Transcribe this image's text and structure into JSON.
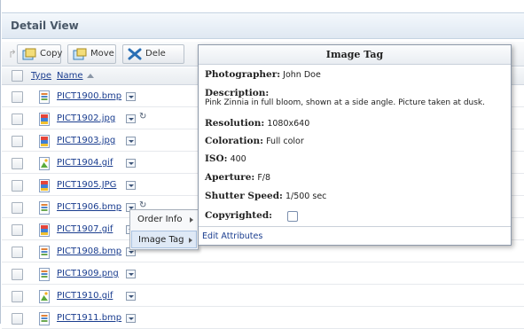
{
  "panel": {
    "title": "Detail View"
  },
  "toolbar": {
    "disabled_icon": "↱",
    "buttons": [
      {
        "label": "Copy",
        "icon": "copy-icon"
      },
      {
        "label": "Move",
        "icon": "move-icon"
      },
      {
        "label": "Dele",
        "icon": "delete-icon"
      }
    ]
  },
  "columns": {
    "type": "Type",
    "name": "Name"
  },
  "files": [
    {
      "name": "PICT1900.bmp",
      "kind": "bmp"
    },
    {
      "name": "PICT1902.jpg",
      "kind": "jpg",
      "extra": "↻"
    },
    {
      "name": "PICT1903.jpg",
      "kind": "jpg"
    },
    {
      "name": "PICT1904.gif",
      "kind": "gif"
    },
    {
      "name": "PICT1905.JPG",
      "kind": "jpg"
    },
    {
      "name": "PICT1906.bmp",
      "kind": "bmp",
      "extra": "↻"
    },
    {
      "name": "PICT1907.gif",
      "kind": "jpg"
    },
    {
      "name": "PICT1908.bmp",
      "kind": "bmp"
    },
    {
      "name": "PICT1909.png",
      "kind": "bmp"
    },
    {
      "name": "PICT1910.gif",
      "kind": "gif"
    },
    {
      "name": "PICT1911.bmp",
      "kind": "bmp"
    }
  ],
  "context_menu": {
    "items": [
      {
        "label": "Order Info"
      },
      {
        "label": "Image Tag"
      }
    ]
  },
  "image_tag": {
    "title": "Image Tag",
    "photographer_label": "Photographer:",
    "photographer": "John Doe",
    "description_label": "Description:",
    "description": "Pink Zinnia in full bloom, shown at a side angle. Picture taken at dusk.",
    "resolution_label": "Resolution:",
    "resolution": "1080x640",
    "coloration_label": "Coloration:",
    "coloration": "Full color",
    "iso_label": "ISO:",
    "iso": "400",
    "aperture_label": "Aperture:",
    "aperture": "F/8",
    "shutter_label": "Shutter Speed:",
    "shutter": "1/500 sec",
    "copyrighted_label": "Copyrighted:",
    "edit_link": "Edit Attributes"
  }
}
